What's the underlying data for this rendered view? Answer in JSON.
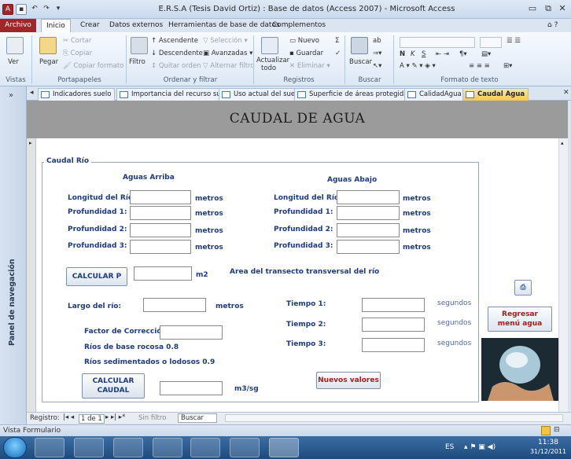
{
  "window": {
    "title": "E.R.S.A (Tesis David Ortiz) : Base de datos (Access 2007)  -  Microsoft Access"
  },
  "menu": {
    "file": "Archivo",
    "tabs": [
      "Inicio",
      "Crear",
      "Datos externos",
      "Herramientas de base de datos",
      "Complementos"
    ]
  },
  "ribbon": {
    "vistas": {
      "ver": "Ver",
      "group": "Vistas"
    },
    "portapapeles": {
      "pegar": "Pegar",
      "cortar": "Cortar",
      "copiar": "Copiar",
      "copiar_formato": "Copiar formato",
      "group": "Portapapeles"
    },
    "ordenar": {
      "filtro": "Filtro",
      "ascendente": "Ascendente",
      "descendente": "Descendente",
      "quitar_orden": "Quitar orden",
      "seleccion": "Selección",
      "avanzadas": "Avanzadas",
      "alternar_filtro": "Alternar filtro",
      "group": "Ordenar y filtrar"
    },
    "registros": {
      "actualizar": "Actualizar",
      "todo": "todo",
      "nuevo": "Nuevo",
      "guardar": "Guardar",
      "eliminar": "Eliminar",
      "group": "Registros"
    },
    "buscar": {
      "buscar": "Buscar",
      "group": "Buscar"
    },
    "formato": {
      "group": "Formato de texto"
    }
  },
  "navpane": {
    "label": "Panel de navegación"
  },
  "doctabs": [
    "Indicadores suelo",
    "Importancia del recurso suelo",
    "Uso actual del suelo",
    "Superficie de áreas protegidas",
    "CalidadAgua",
    "Caudal Agua"
  ],
  "form": {
    "title": "CAUDAL DE AGUA",
    "frame_title": "Caudal Río",
    "aguas_arriba": "Aguas Arriba",
    "aguas_abajo": "Aguas Abajo",
    "longitud": "Longitud del Río:",
    "prof1": "Profundidad 1:",
    "prof2": "Profundidad 2:",
    "prof3": "Profundidad 3:",
    "metros": "metros",
    "calcular_p": "CALCULAR P",
    "m2": "m2",
    "area_label": "Area del transecto transversal del río",
    "largo": "Largo del río:",
    "tiempo1": "Tiempo 1:",
    "tiempo2": "Tiempo 2:",
    "tiempo3": "Tiempo 3:",
    "segundos": "segundos",
    "factor": "Factor de Corrección",
    "rocosa": "Ríos de base rocosa 0.8",
    "sedimentados": "Ríos sedimentados o lodosos 0.9",
    "calcular_caudal_1": "CALCULAR",
    "calcular_caudal_2": "CAUDAL",
    "m3sg": "m3/sg",
    "nuevos": "Nuevos valores",
    "regresar_1": "Regresar",
    "regresar_2": "menú agua"
  },
  "recnav": {
    "registro": "Registro:",
    "pos": "1 de 1",
    "sin_filtro": "Sin filtro",
    "buscar": "Buscar"
  },
  "status": {
    "text": "Vista Formulario"
  },
  "taskbar": {
    "lang": "ES",
    "time": "11:38",
    "date": "31/12/2011"
  }
}
